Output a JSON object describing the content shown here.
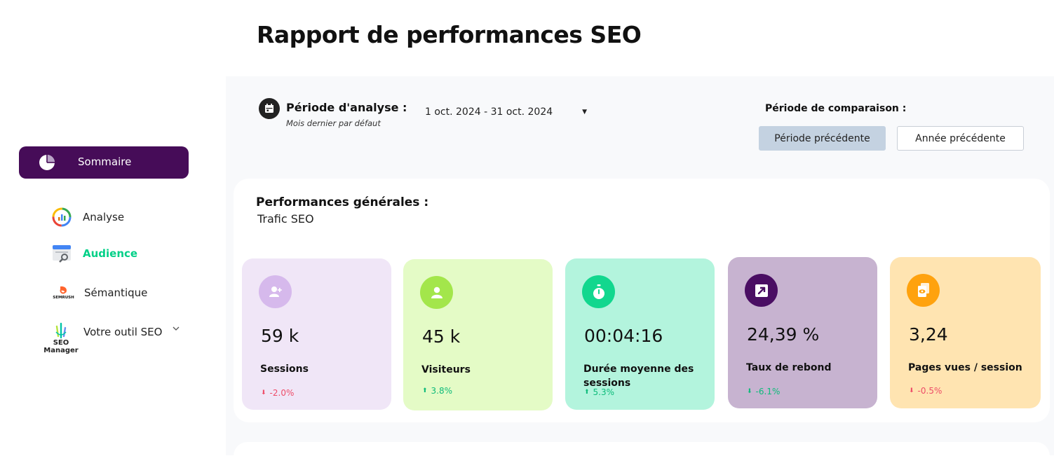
{
  "page": {
    "title": "Rapport de performances SEO"
  },
  "sidebar": {
    "items": [
      {
        "label": "Sommaire",
        "active": true
      },
      {
        "label": "Analyse"
      },
      {
        "label": "Audience",
        "highlight": true
      },
      {
        "label": "Sémantique"
      },
      {
        "label": "Votre outil SEO",
        "logo_text": "SEO Manager",
        "has_dropdown": true
      }
    ],
    "semrush_text": "SEMRUSH"
  },
  "period": {
    "title": "Période d'analyse :",
    "subtitle": "Mois dernier par défaut",
    "range": "1 oct. 2024 - 31 oct. 2024"
  },
  "comparison": {
    "title": "Période de comparaison :",
    "buttons": [
      "Période précédente",
      "Année précédente"
    ],
    "selected": "Période précédente"
  },
  "performance": {
    "title": "Performances générales :",
    "subtitle": "Trafic SEO",
    "kpis": [
      {
        "value": "59 k",
        "label": "Sessions",
        "delta": "-2.0%",
        "direction": "down",
        "bg": "#f0e6f7",
        "icon_bg": "#d6b9ec",
        "icon": "add-user-icon"
      },
      {
        "value": "45 k",
        "label": "Visiteurs",
        "delta": "3.8%",
        "direction": "up",
        "bg": "#e4fbc6",
        "icon_bg": "#a3e64b",
        "icon": "user-icon"
      },
      {
        "value": "00:04:16",
        "label": "Durée moyenne des sessions",
        "delta": "5.3%",
        "direction": "up",
        "bg": "#b3f4dd",
        "icon_bg": "#12d78e",
        "icon": "stopwatch-icon"
      },
      {
        "value": "24,39 %",
        "label": "Taux de rebond",
        "delta": "-6.1%",
        "direction": "up",
        "bg": "#c7b3d0",
        "icon_bg": "#4a0e63",
        "icon": "external-arrow-icon"
      },
      {
        "value": "3,24",
        "label": "Pages vues / session",
        "delta": "-0.5%",
        "direction": "down",
        "bg": "#ffe4b1",
        "icon_bg": "#ffa20e",
        "icon": "page-view-icon"
      }
    ]
  }
}
